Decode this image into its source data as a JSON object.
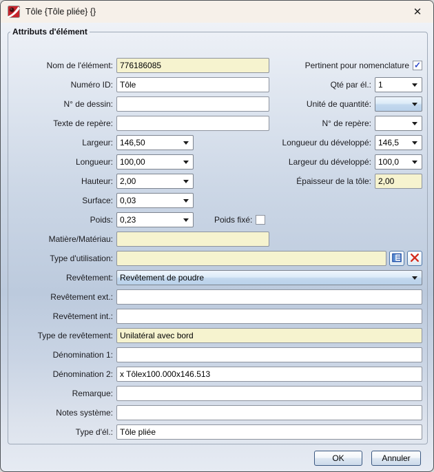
{
  "window": {
    "title": "Tôle {Tôle pliée} {}",
    "close_glyph": "✕"
  },
  "group_legend": "Attributs d'élément",
  "fields": {
    "nom": {
      "label": "Nom de l'élément:",
      "value": "776186085"
    },
    "pertinent": {
      "label": "Pertinent pour nomenclature",
      "checked": true
    },
    "numero_id": {
      "label": "Numéro ID:",
      "value": "Tôle"
    },
    "qte_par_el": {
      "label": "Qté par él.:",
      "value": "1"
    },
    "no_dessin": {
      "label": "N° de dessin:",
      "value": ""
    },
    "unite_quantite": {
      "label": "Unité de quantité:",
      "value": ""
    },
    "texte_repere": {
      "label": "Texte de repère:",
      "value": ""
    },
    "no_repere": {
      "label": "N° de repère:",
      "value": ""
    },
    "largeur": {
      "label": "Largeur:",
      "value": "146,50"
    },
    "longueur_developpe": {
      "label": "Longueur du développé:",
      "value": "146,5"
    },
    "longueur": {
      "label": "Longueur:",
      "value": "100,00"
    },
    "largeur_developpe": {
      "label": "Largeur du développé:",
      "value": "100,0"
    },
    "hauteur": {
      "label": "Hauteur:",
      "value": "2,00"
    },
    "epaisseur": {
      "label": "Épaisseur de la tôle:",
      "value": "2,00"
    },
    "surface": {
      "label": "Surface:",
      "value": "0,03"
    },
    "poids": {
      "label": "Poids:",
      "value": "0,23"
    },
    "poids_fixe": {
      "label": "Poids fixé:",
      "checked": false
    },
    "matiere": {
      "label": "Matière/Matériau:",
      "value": ""
    },
    "type_utilisation": {
      "label": "Type d'utilisation:",
      "value": ""
    },
    "revetement": {
      "label": "Revêtement:",
      "value": "Revêtement de poudre"
    },
    "revetement_ext": {
      "label": "Revêtement ext.:",
      "value": ""
    },
    "revetement_int": {
      "label": "Revêtement int.:",
      "value": ""
    },
    "type_revetement": {
      "label": "Type de revêtement:",
      "value": "Unilatéral avec bord"
    },
    "denomination1": {
      "label": "Dénomination 1:",
      "value": ""
    },
    "denomination2": {
      "label": "Dénomination 2:",
      "value": "x Tôlex100.000x146.513"
    },
    "remarque": {
      "label": "Remarque:",
      "value": ""
    },
    "notes_systeme": {
      "label": "Notes système:",
      "value": ""
    },
    "type_el": {
      "label": "Type d'él.:",
      "value": "Tôle pliée"
    }
  },
  "buttons": {
    "ok": "OK",
    "cancel": "Annuler"
  },
  "icons": {
    "app": "sheet-metal-app-icon",
    "catalog": "catalog-table-icon",
    "delete": "red-x-icon",
    "dropdown": "chevron-down-icon"
  },
  "colors": {
    "mandatory_field_yellow": "#f6f3cf",
    "combo_blue_top": "#f0f6fc",
    "combo_blue_bottom": "#b9d1ea",
    "titlebar": "#f6f0e9",
    "app_icon_red": "#c6252d",
    "check_blue": "#2743c8",
    "delete_x_red": "#d42a1c"
  }
}
